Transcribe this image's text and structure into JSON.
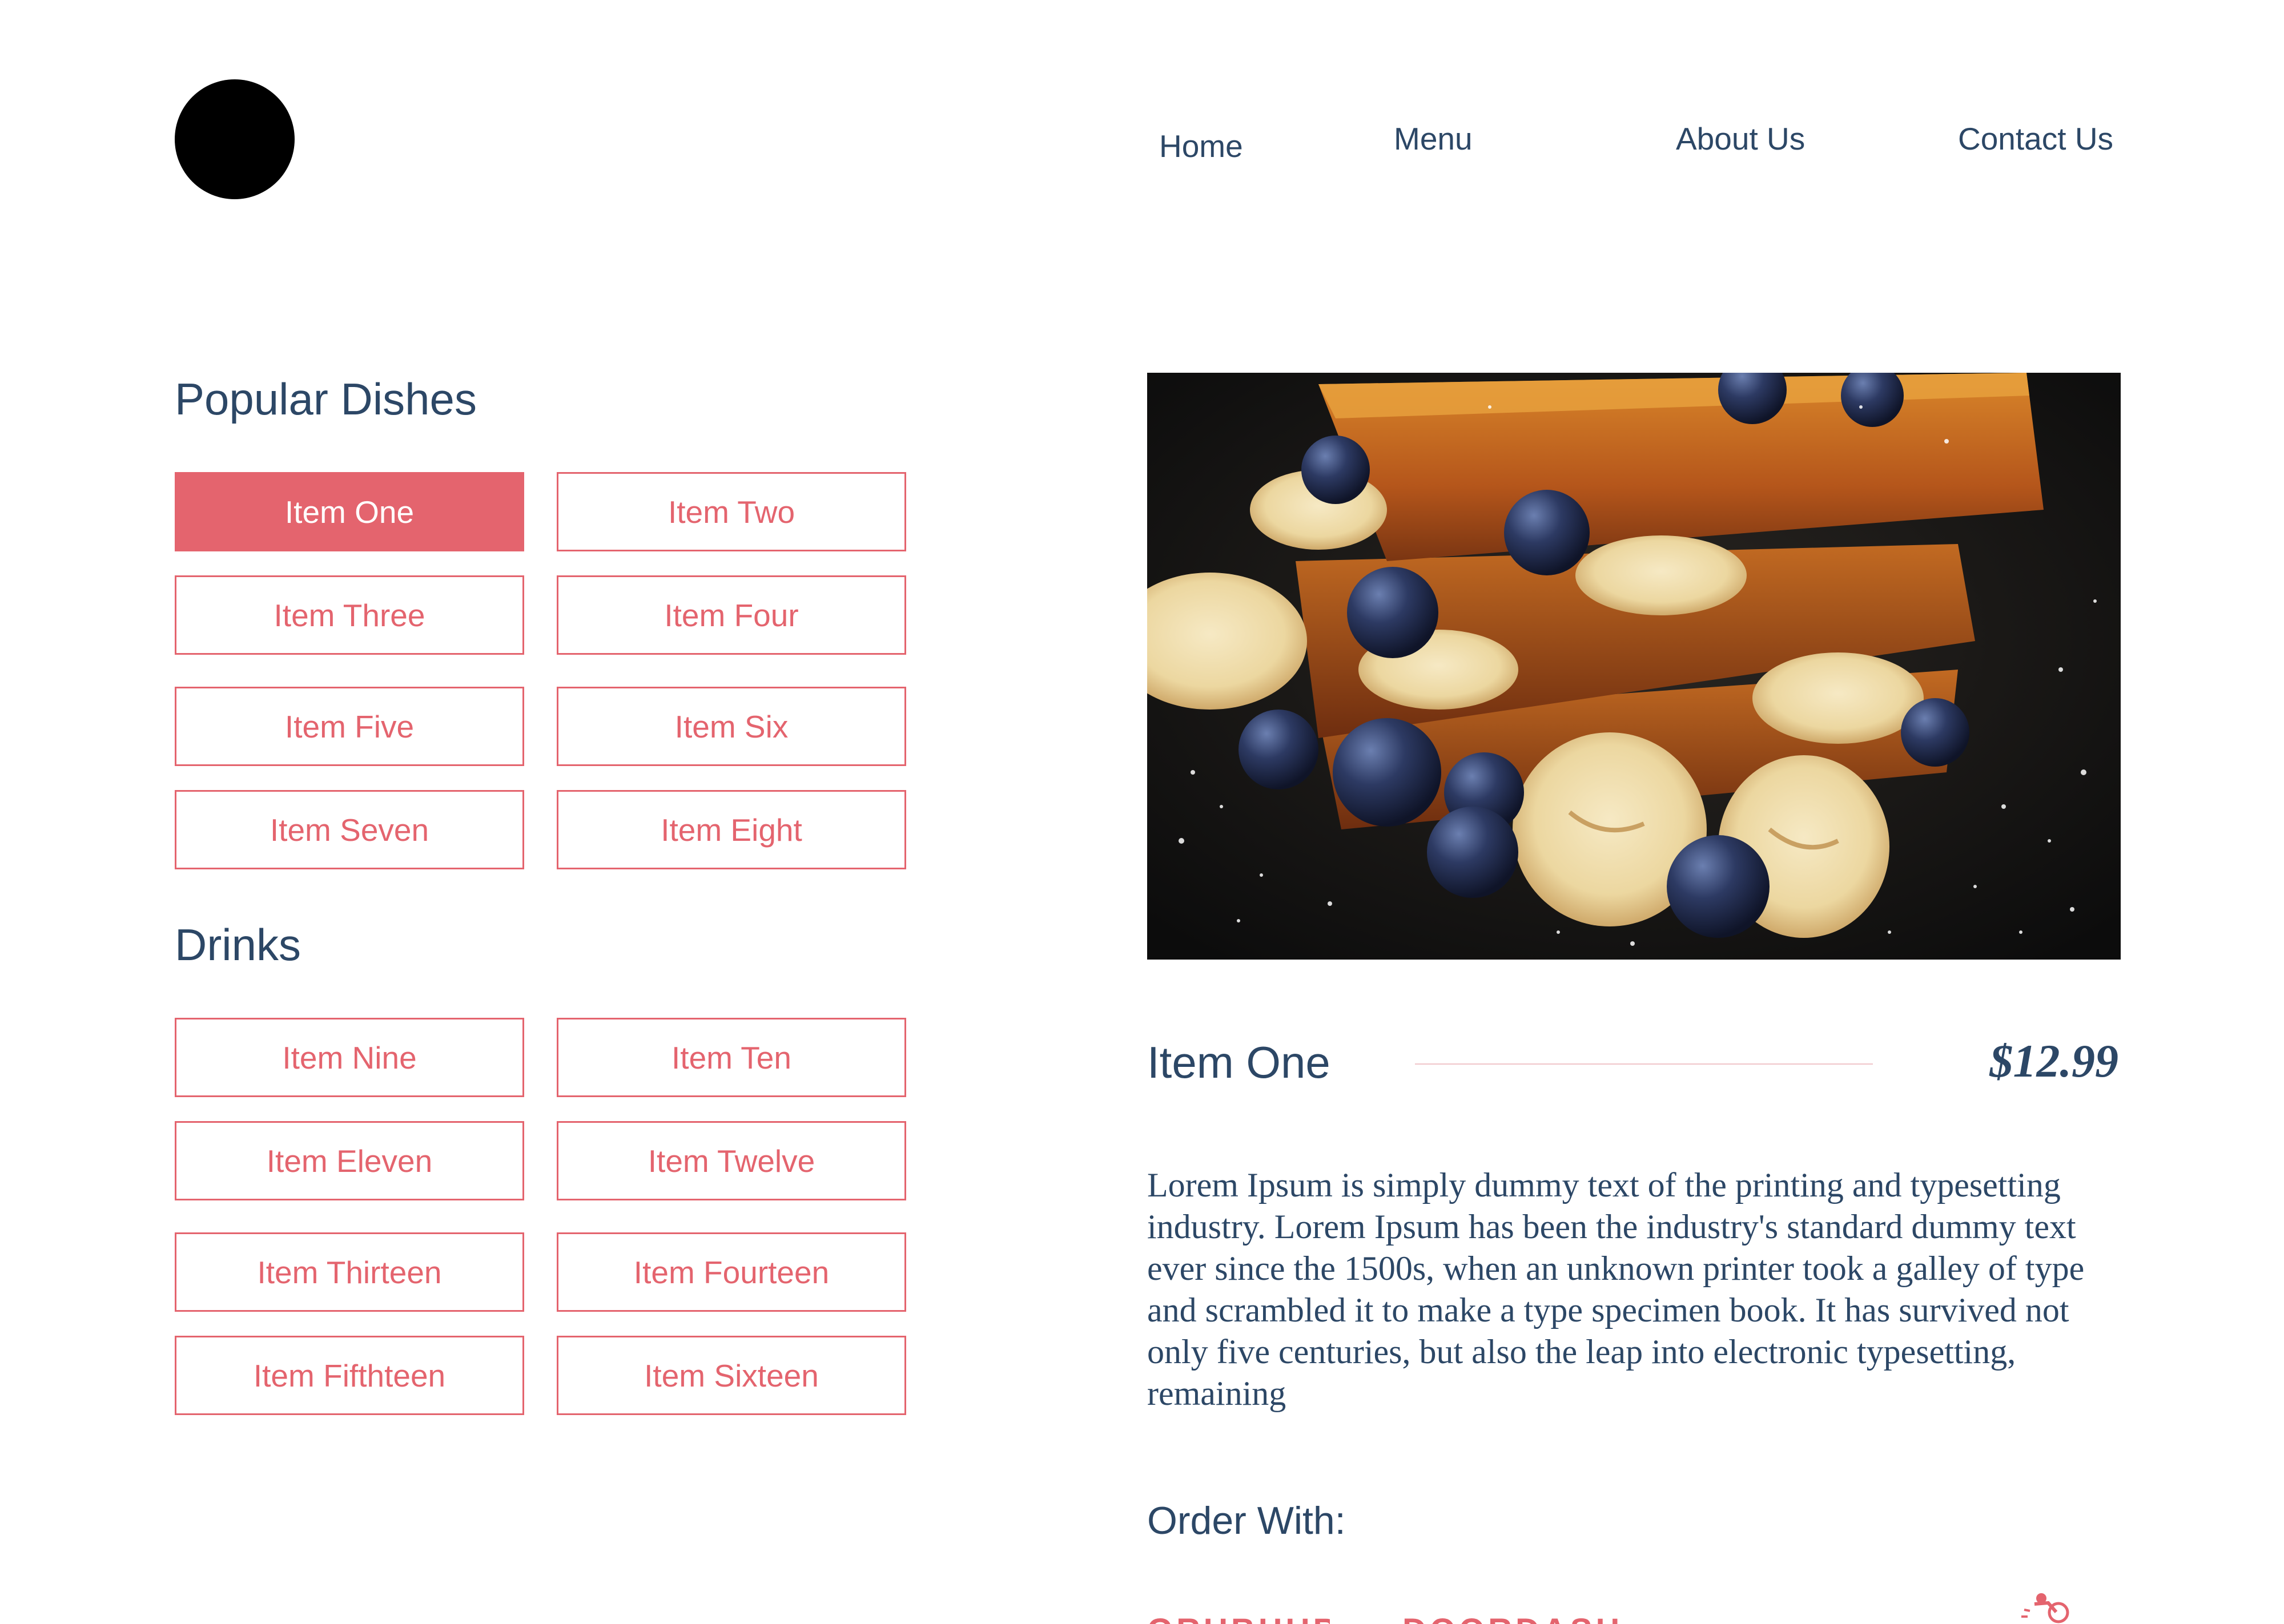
{
  "nav": {
    "links": [
      "Home",
      "Menu",
      "About Us",
      "Contact Us"
    ]
  },
  "popular": {
    "title": "Popular Dishes",
    "items": [
      "Item One",
      "Item Two",
      "Item Three",
      "Item Four",
      "Item Five",
      "Item Six",
      "Item Seven",
      "Item Eight"
    ],
    "active_index": 0
  },
  "drinks": {
    "title": "Drinks",
    "items": [
      "Item Nine",
      "Item Ten",
      "Item Eleven",
      "Item Twelve",
      "Item Thirteen",
      "Item Fourteen",
      "Item Fifthteen",
      "Item Sixteen"
    ]
  },
  "detail": {
    "image_icon": "french-toast-photo",
    "name": "Item One",
    "price": "$12.99",
    "description": "Lorem Ipsum is simply dummy text of the printing and typesetting industry. Lorem Ipsum has been the industry's standard dummy text ever since the 1500s, when an unknown printer took a galley of type and scrambled it to make a type specimen book. It has survived not only five centuries, but also the leap into electronic typesetting, remaining"
  },
  "order": {
    "title": "Order With:",
    "partners": [
      "GRUBHUB",
      "DOORDASH",
      "",
      "",
      "postmates-icon"
    ]
  },
  "colors": {
    "accent": "#e4646e",
    "text": "#2c4766",
    "logo": "#000000"
  }
}
